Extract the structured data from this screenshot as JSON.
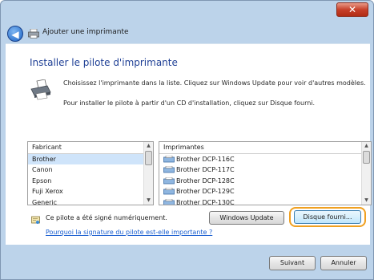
{
  "window": {
    "close_label": "✕",
    "nav_title": "Ajouter une imprimante"
  },
  "page": {
    "heading": "Installer le pilote d'imprimante",
    "instruction_1": "Choisissez l'imprimante dans la liste. Cliquez sur Windows Update pour voir d'autres modèles.",
    "instruction_2": "Pour installer le pilote à partir d'un CD d'installation, cliquez sur Disque fourni."
  },
  "manufacturers": {
    "header": "Fabricant",
    "items": [
      "Brother",
      "Canon",
      "Epson",
      "Fuji Xerox",
      "Generic"
    ]
  },
  "printers": {
    "header": "Imprimantes",
    "items": [
      "Brother DCP-116C",
      "Brother DCP-117C",
      "Brother DCP-128C",
      "Brother DCP-129C",
      "Brother DCP-130C"
    ]
  },
  "signature": {
    "text": "Ce pilote a été signé numériquement.",
    "link": "Pourquoi la signature du pilote est-elle importante ?"
  },
  "buttons": {
    "windows_update": "Windows Update",
    "have_disk": "Disque fourni...",
    "next": "Suivant",
    "cancel": "Annuler"
  },
  "colors": {
    "heading": "#1e3f95",
    "link": "#1a5fd0",
    "highlight": "#f0a020",
    "selection": "#cfe4fa"
  },
  "icons": [
    "back-arrow-icon",
    "printer-icon",
    "close-icon",
    "certificate-icon",
    "scroll-up-icon",
    "scroll-down-icon"
  ]
}
